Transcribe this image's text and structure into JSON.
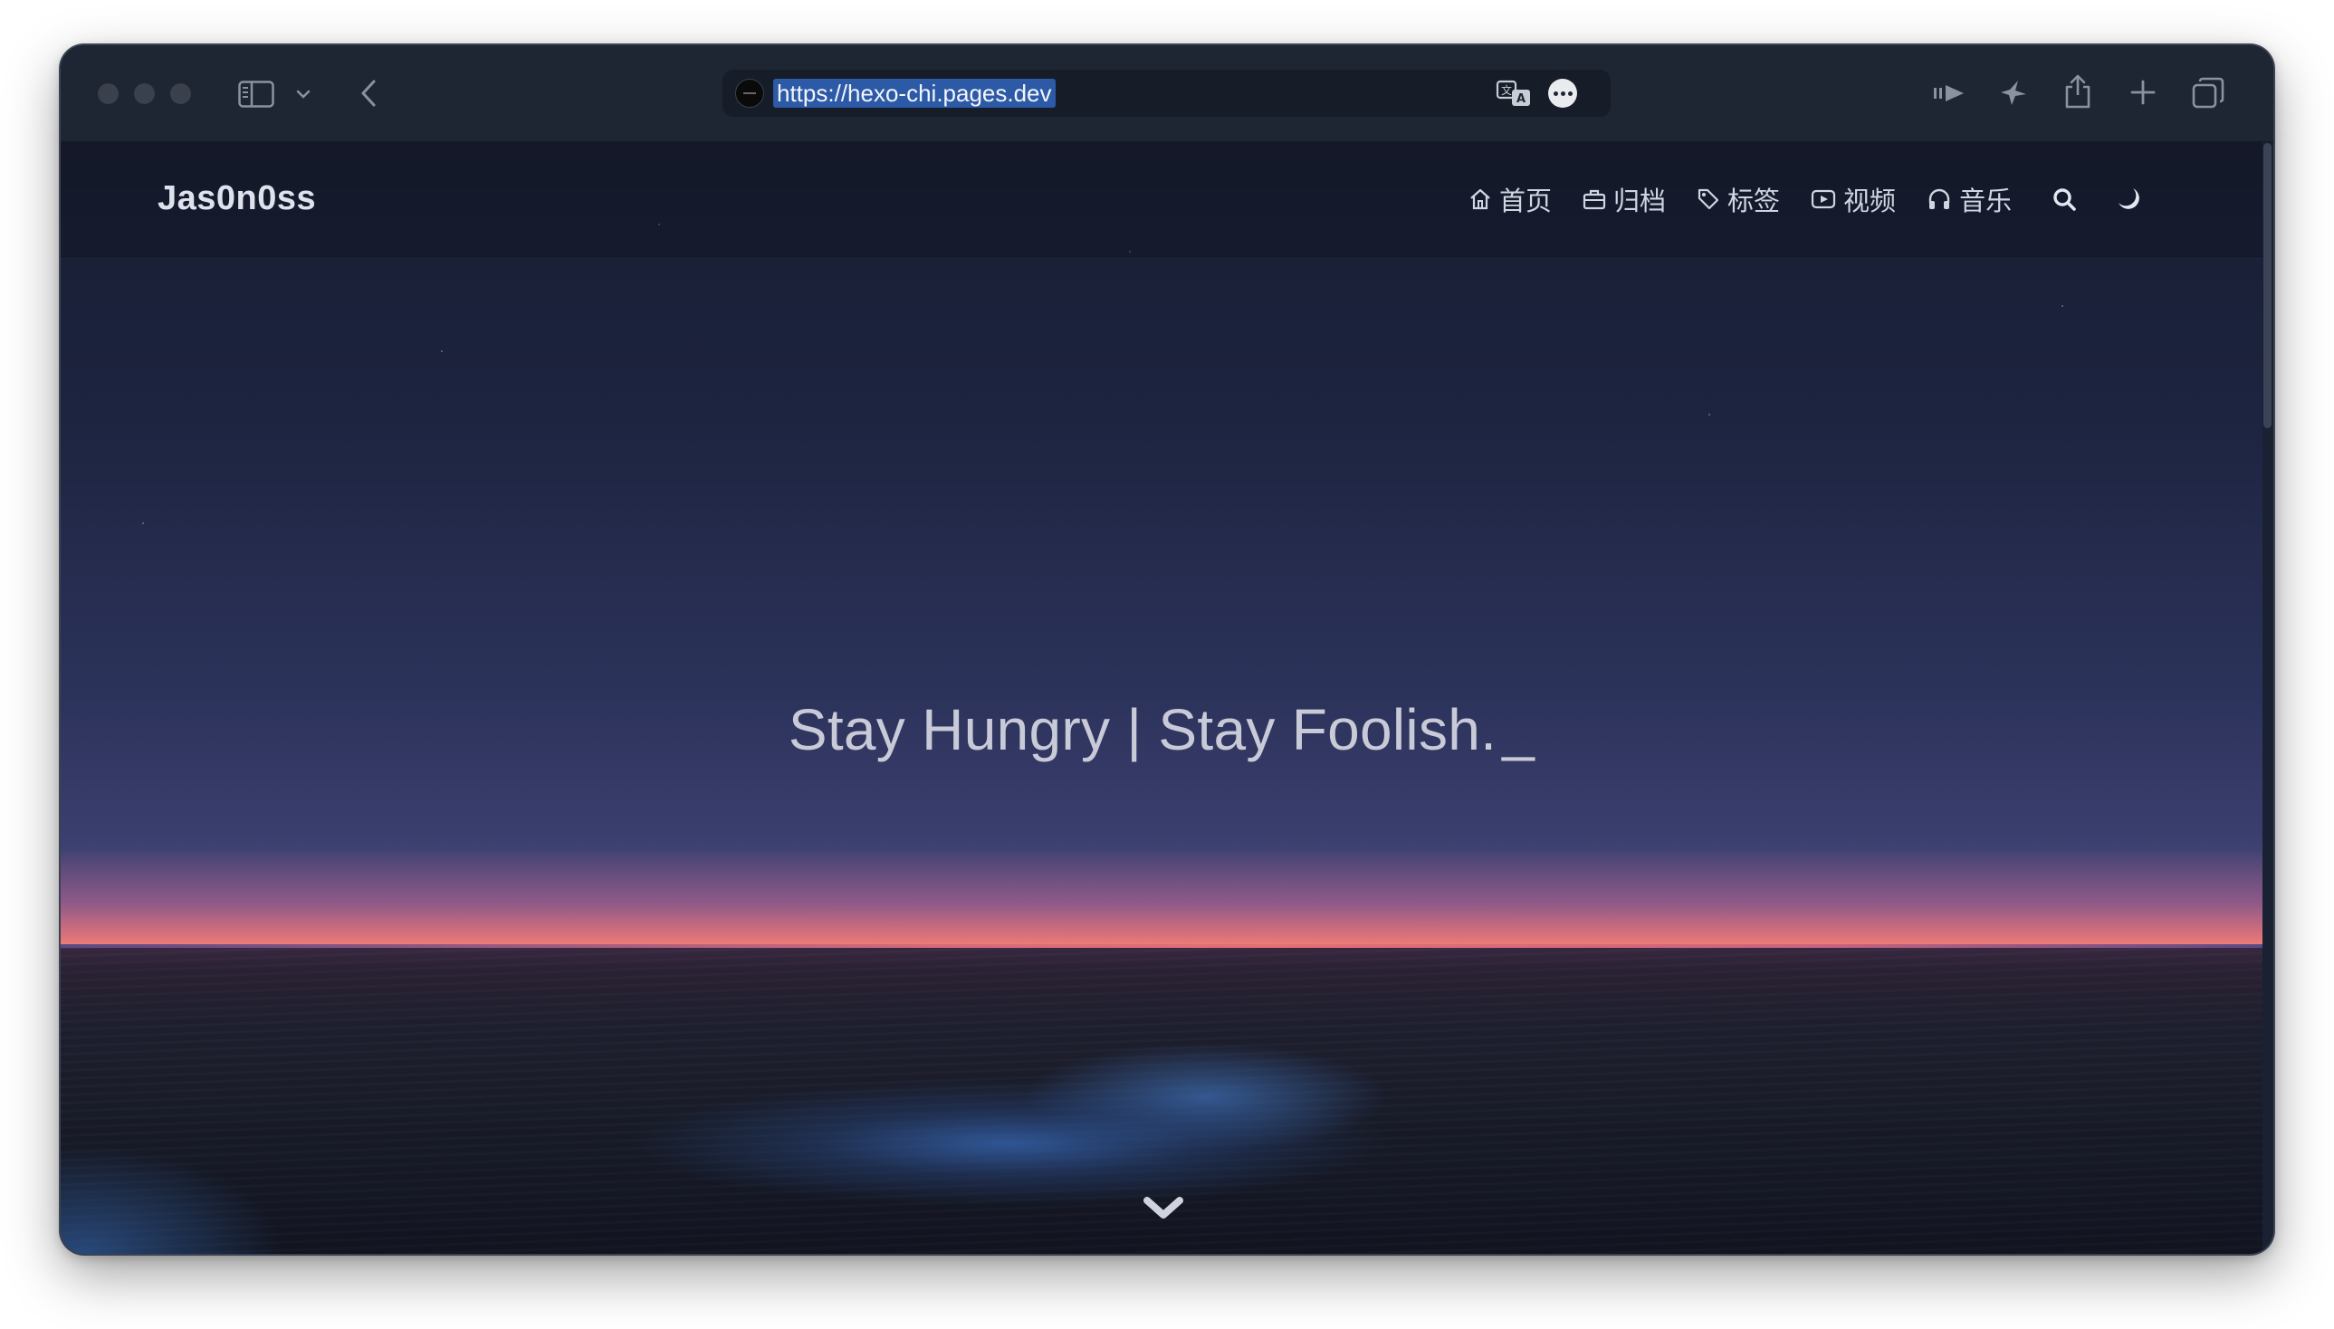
{
  "browser": {
    "url": "https://hexo-chi.pages.dev",
    "toolbar_icons": [
      "sidebar-icon",
      "chevron-down-icon",
      "back-icon",
      "translate-icon",
      "more-icon",
      "reader-icon",
      "bird-icon",
      "share-icon",
      "plus-icon",
      "tabs-icon"
    ]
  },
  "site": {
    "brand": "Jas0n0ss",
    "nav": [
      {
        "icon": "home-icon",
        "label": "首页"
      },
      {
        "icon": "archive-icon",
        "label": "归档"
      },
      {
        "icon": "tag-icon",
        "label": "标签"
      },
      {
        "icon": "video-icon",
        "label": "视频"
      },
      {
        "icon": "headphones-icon",
        "label": "音乐"
      }
    ],
    "nav_actions": [
      "search-icon",
      "moon-icon"
    ]
  },
  "hero": {
    "title": "Stay Hungry | Stay Foolish.",
    "cursor": "_",
    "scroll_icon": "chevron-down-icon"
  },
  "colors": {
    "sky_top": "#171d30",
    "horizon": "#e46f74",
    "sea": "#181b28",
    "title": "#c9cad8"
  }
}
